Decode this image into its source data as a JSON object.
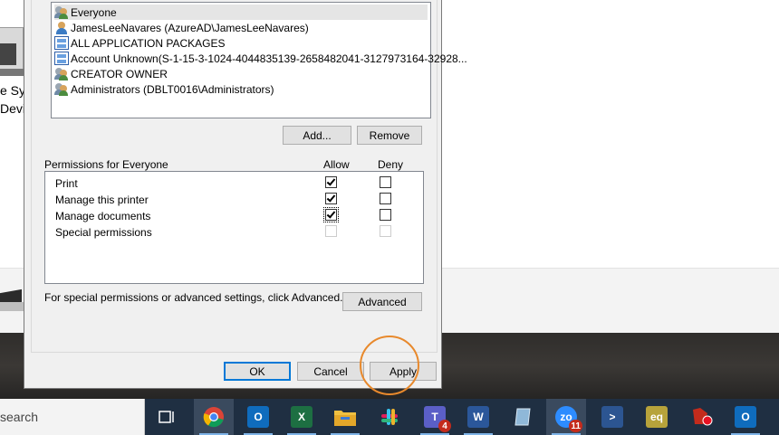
{
  "background_window": {
    "label_line1": "e Sys",
    "label_line2": "Devic"
  },
  "dialog": {
    "names": [
      {
        "label": "Everyone",
        "icon": "group-icon",
        "selected": true
      },
      {
        "label": "JamesLeeNavares (AzureAD\\JamesLeeNavares)",
        "icon": "user-icon",
        "selected": false
      },
      {
        "label": "ALL APPLICATION PACKAGES",
        "icon": "package-icon",
        "selected": false
      },
      {
        "label": "Account Unknown(S-1-15-3-1024-4044835139-2658482041-3127973164-32928...",
        "icon": "package-icon",
        "selected": false
      },
      {
        "label": "CREATOR OWNER",
        "icon": "group-icon",
        "selected": false
      },
      {
        "label": "Administrators (DBLT0016\\Administrators)",
        "icon": "group-icon",
        "selected": false
      }
    ],
    "add_label": "Add...",
    "remove_label": "Remove",
    "permissions_title": "Permissions for Everyone",
    "allow_header": "Allow",
    "deny_header": "Deny",
    "permissions": [
      {
        "label": "Print",
        "allow": true,
        "deny": false,
        "enabled": true
      },
      {
        "label": "Manage this printer",
        "allow": true,
        "deny": false,
        "enabled": true
      },
      {
        "label": "Manage documents",
        "allow": true,
        "deny": false,
        "enabled": true,
        "focused": true
      },
      {
        "label": "Special permissions",
        "allow": false,
        "deny": false,
        "enabled": false
      }
    ],
    "advanced_note": "For special permissions or advanced settings, click Advanced.",
    "advanced_label": "Advanced",
    "ok_label": "OK",
    "cancel_label": "Cancel",
    "apply_label": "Apply"
  },
  "taskbar": {
    "search_text": "search",
    "apps": [
      {
        "name": "task-view",
        "glyph": "",
        "color": "#1f2f42"
      },
      {
        "name": "chrome",
        "glyph": "",
        "color": "#db4437",
        "active": true
      },
      {
        "name": "outlook",
        "glyph": "O",
        "color": "#0f6cbd"
      },
      {
        "name": "excel",
        "glyph": "X",
        "color": "#1d6f42"
      },
      {
        "name": "file-explorer",
        "glyph": "",
        "color": "#f0c040"
      },
      {
        "name": "slack",
        "glyph": "#",
        "color": "#ffffff"
      },
      {
        "name": "teams",
        "glyph": "T",
        "color": "#5b5fc7",
        "badge": "4"
      },
      {
        "name": "word",
        "glyph": "W",
        "color": "#2b579a"
      },
      {
        "name": "snipping",
        "glyph": "",
        "color": "#8fb8d8"
      },
      {
        "name": "zoom",
        "glyph": "zo",
        "color": "#2d8cff",
        "badge": "11",
        "active": true
      },
      {
        "name": "powershell",
        "glyph": ">",
        "color": "#2c5591"
      },
      {
        "name": "eq",
        "glyph": "eq",
        "color": "#b7a33b"
      },
      {
        "name": "recorder",
        "glyph": "",
        "color": "#c42b1c"
      },
      {
        "name": "outlook-mail",
        "glyph": "O",
        "color": "#0f6cbd"
      }
    ]
  }
}
